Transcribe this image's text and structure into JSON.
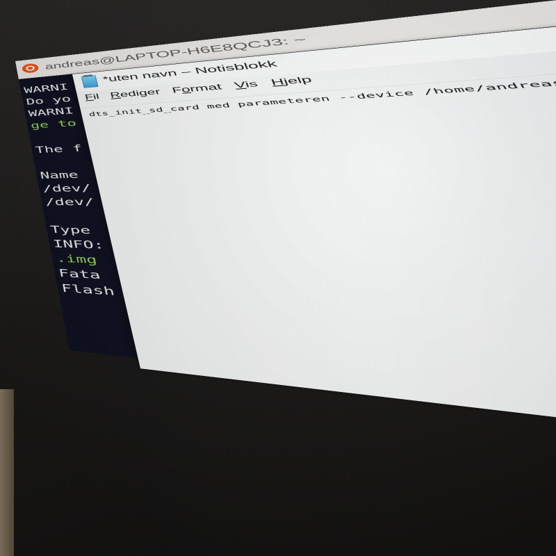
{
  "terminal": {
    "title": "andreas@LAPTOP-H6E8QCJ3: ~",
    "lines": [
      {
        "text": "WARNI",
        "color": "#e8e8e8"
      },
      {
        "text": "Do yo",
        "color": "#e8e8e8"
      },
      {
        "text": "WARNI",
        "color": "#e8e8e8"
      },
      {
        "text": "ge to",
        "color": "#8fd14f"
      },
      {
        "text": "",
        "color": "#e8e8e8"
      },
      {
        "text": "The f",
        "color": "#e8e8e8"
      },
      {
        "text": "",
        "color": "#e8e8e8"
      },
      {
        "text": "Name",
        "color": "#e8e8e8"
      },
      {
        "text": "/dev/",
        "color": "#e8e8e8"
      },
      {
        "text": "/dev/",
        "color": "#e8e8e8"
      },
      {
        "text": "",
        "color": "#e8e8e8"
      },
      {
        "text": "Type",
        "color": "#e8e8e8"
      },
      {
        "text": "INFO:",
        "color": "#e8e8e8"
      },
      {
        "text": ".img",
        "color": "#8fd14f"
      },
      {
        "text": "Fata",
        "color": "#e8e8e8"
      },
      {
        "text": "Flash",
        "color": "#e8e8e8"
      }
    ]
  },
  "notepad": {
    "title": "*uten navn – Notisblokk",
    "menu": [
      {
        "label": "Fil",
        "accel": "F",
        "rest": "il"
      },
      {
        "label": "Rediger",
        "accel": "R",
        "rest": "ediger"
      },
      {
        "label": "Format",
        "accel": "o",
        "pre": "F",
        "rest": "rmat"
      },
      {
        "label": "Vis",
        "accel": "V",
        "rest": "is"
      },
      {
        "label": "Hjelp",
        "accel": "H",
        "rest": "jelp"
      }
    ],
    "content": "dts_init_sd_card med parameteren --device /home/andreas/duckiebot_sd_card.img"
  },
  "colors": {
    "terminal_bg": "#0f1020",
    "terminal_text": "#e8e8e8",
    "terminal_green": "#8fd14f",
    "ubuntu_orange": "#e95420",
    "notepad_bg": "#f3f5f4"
  }
}
